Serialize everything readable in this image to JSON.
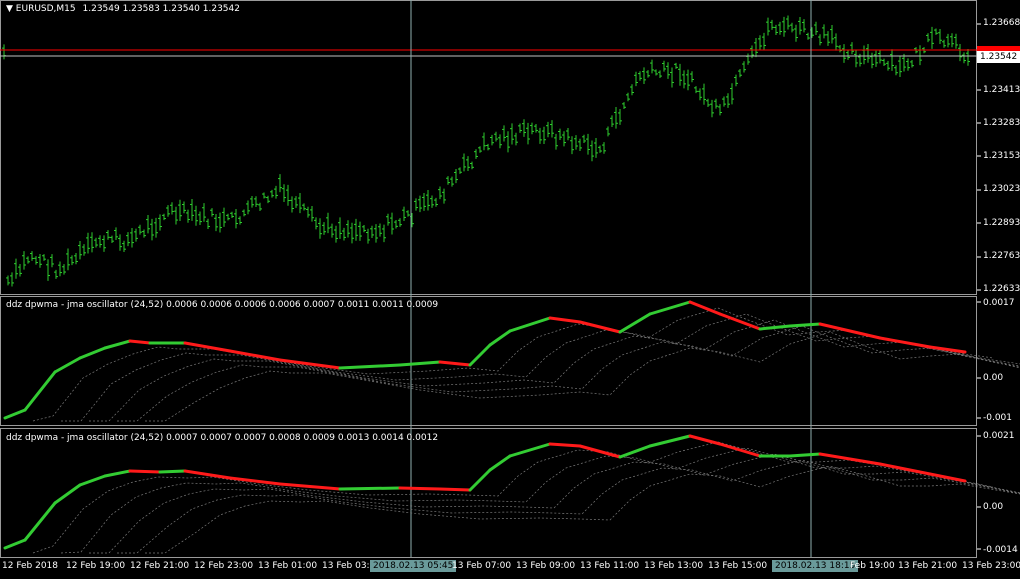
{
  "main_chart": {
    "title": "EURUSD,M15",
    "ohlc": "1.23549 1.23583 1.23540 1.23542",
    "current_price": "1.23542",
    "y_labels": [
      "1.23668",
      "1.23413",
      "1.23283",
      "1.23153",
      "1.23023",
      "1.22893",
      "1.22763",
      "1.22633"
    ],
    "colors": {
      "bars": "#2ecc2e",
      "bid_line": "#ff0000",
      "crosshair": "#8fb0b0"
    }
  },
  "osc1": {
    "label": "ddz dpwma - jma oscillator (24,52) 0.0006 0.0006 0.0006 0.0006 0.0007 0.0011 0.0011 0.0009",
    "y_labels": [
      "0.0017",
      "0.00",
      "-0.001"
    ]
  },
  "osc2": {
    "label": "ddz dpwma - jma oscillator (24,52) 0.0007 0.0007 0.0007 0.0008 0.0009 0.0013 0.0014 0.0012",
    "y_labels": [
      "0.0021",
      "0.00",
      "-0.0014"
    ]
  },
  "x_axis": {
    "labels": [
      "12 Feb 2018",
      "12 Feb 19:00",
      "12 Feb 21:00",
      "12 Feb 23:00",
      "13 Feb 01:00",
      "13 Feb 03:00",
      "13 Feb 07:00",
      "13 Feb 09:00",
      "13 Feb 11:00",
      "13 Feb 13:00",
      "13 Feb 15:00",
      "Feb 19:00",
      "13 Feb 21:00",
      "13 Feb 23:00"
    ],
    "cross1": "2018.02.13 05:45",
    "cross2": "2018.02.13 18:15"
  }
}
